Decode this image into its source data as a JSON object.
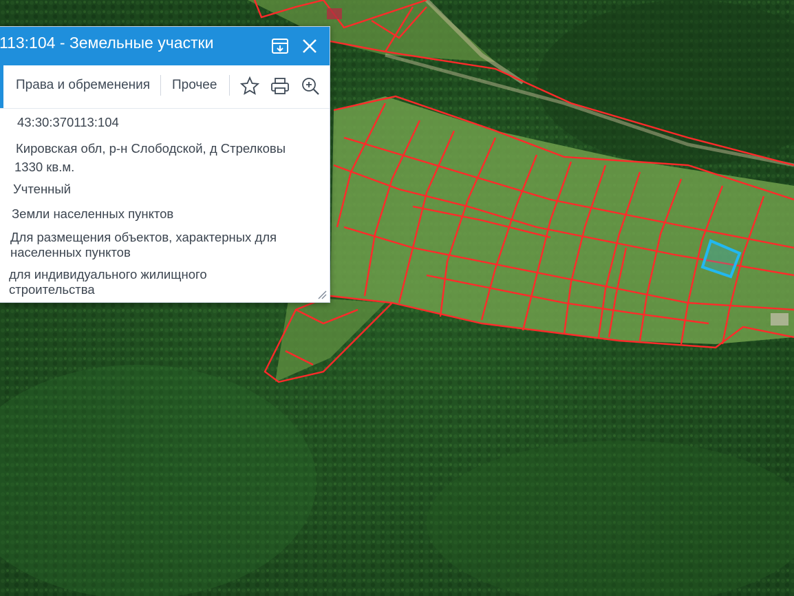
{
  "panel": {
    "title": "113:104 - Земельные участки",
    "tabs": [
      {
        "label": "Права и обременения"
      },
      {
        "label": "Прочее"
      }
    ],
    "fields": [
      {
        "value": "43:30:370113:104"
      },
      {
        "value": "Кировская обл, р-н Слободской, д Стрелковы"
      },
      {
        "value": "1330 кв.м."
      },
      {
        "value": "Учтенный"
      },
      {
        "value": "Земли населенных пунктов"
      },
      {
        "value": "Для размещения объектов, характерных для населенных пунктов"
      },
      {
        "value": "для индивидуального жилищного строительства"
      }
    ],
    "icons": {
      "collapse": "collapse-panel-icon",
      "close": "close-icon",
      "favorite": "star-icon",
      "print": "print-icon",
      "zoom": "zoom-in-icon"
    }
  },
  "map": {
    "parcel_border_color": "#ff2a2a",
    "selected_parcel_color": "#22b8f0",
    "forest_color": "#1f4a1f",
    "clearing_color": "#6e9e4a"
  }
}
